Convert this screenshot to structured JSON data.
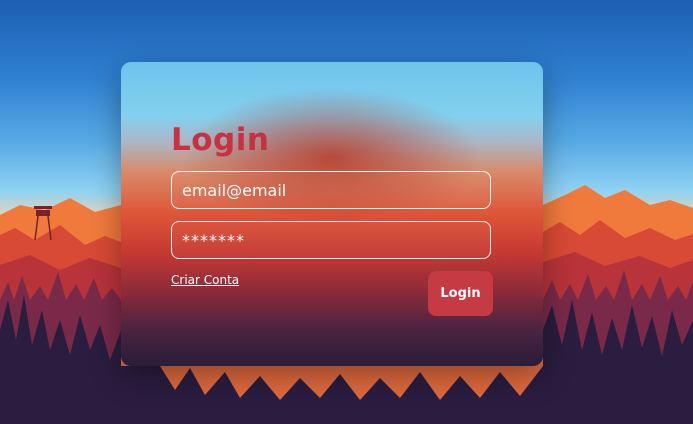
{
  "login_form": {
    "title": "Login",
    "email_placeholder": "email@email",
    "password_placeholder": "*******",
    "create_account_link": "Criar Conta",
    "submit_label": "Login"
  },
  "colors": {
    "accent": "#c8313f",
    "button": "#c63a44",
    "sky_top": "#1d5fb3",
    "mountain_near": "#c9353a",
    "forest_dark": "#2a1d40"
  }
}
